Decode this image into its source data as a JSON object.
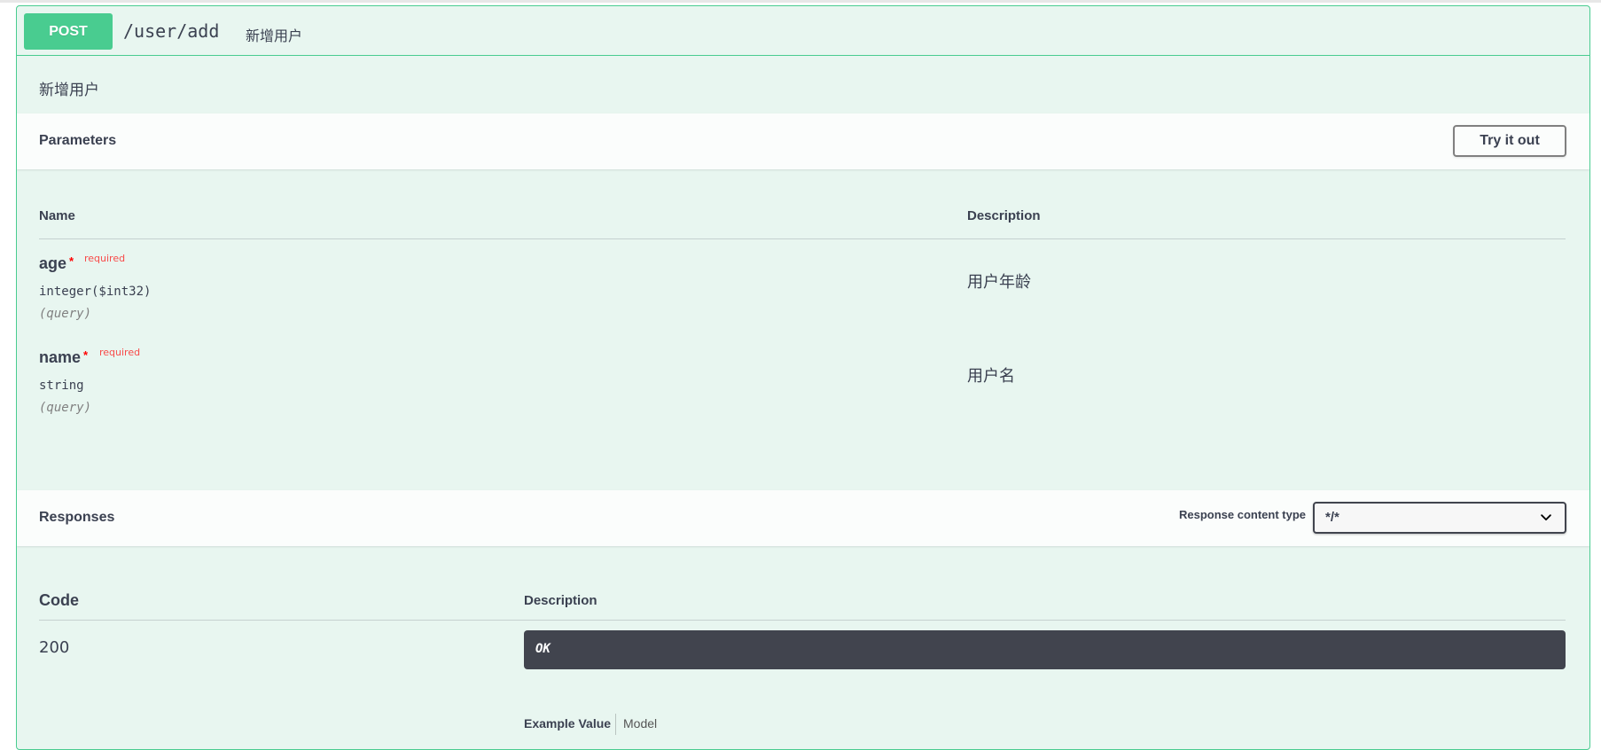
{
  "operation": {
    "method": "POST",
    "path": "/user/add",
    "summary": "新增用户",
    "description": "新增用户"
  },
  "parameters": {
    "title": "Parameters",
    "try_button": "Try it out",
    "col_name": "Name",
    "col_description": "Description",
    "items": [
      {
        "name": "age",
        "star": "*",
        "required": "required",
        "type": "integer($int32)",
        "in": "(query)",
        "description": "用户年龄"
      },
      {
        "name": "name",
        "star": "*",
        "required": "required",
        "type": "string",
        "in": "(query)",
        "description": "用户名"
      }
    ]
  },
  "responses": {
    "title": "Responses",
    "content_type_label": "Response content type",
    "content_type_value": "*/*",
    "col_code": "Code",
    "col_description": "Description",
    "items": [
      {
        "code": "200",
        "description": "OK",
        "tab_example": "Example Value",
        "tab_model": "Model"
      }
    ]
  },
  "colors": {
    "post": "#49cc90",
    "post_bg": "#e8f6f0",
    "ok_box": "#41444e",
    "required": "#ff0000"
  }
}
